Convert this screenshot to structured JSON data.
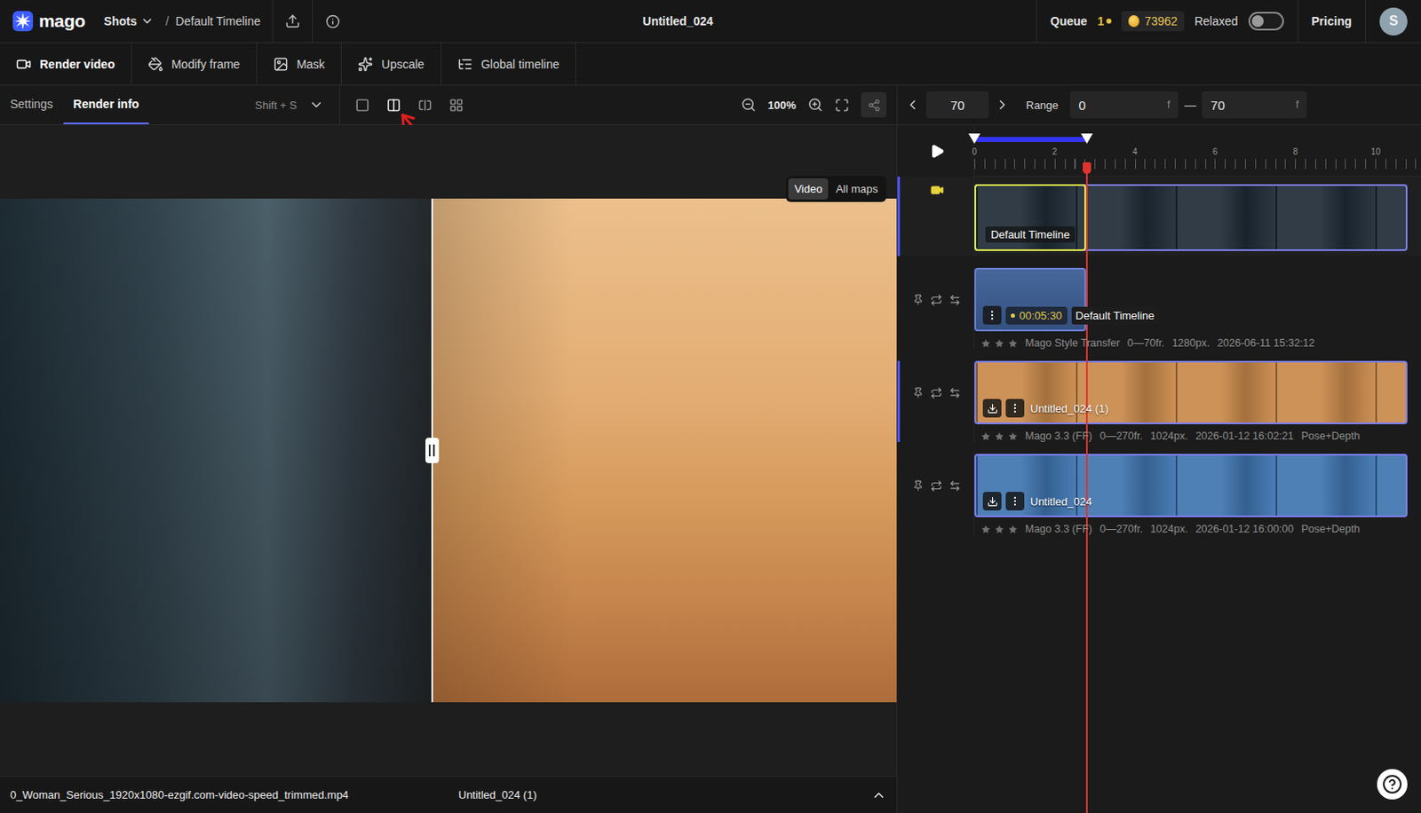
{
  "topbar": {
    "logo": "mago",
    "project": "Shots",
    "separator": "/",
    "timeline": "Default Timeline",
    "title": "Untitled_024",
    "queue": "Queue",
    "queue_count": "1",
    "credits": "73962",
    "relaxed": {
      "label": "Relaxed",
      "on": false
    },
    "pricing": "Pricing",
    "avatar": "S"
  },
  "tools": [
    {
      "label": "Render video",
      "selected": true
    },
    {
      "label": "Modify frame",
      "selected": false
    },
    {
      "label": "Mask",
      "selected": false
    },
    {
      "label": "Upscale",
      "selected": false
    },
    {
      "label": "Global timeline",
      "selected": false
    }
  ],
  "panel_tabs": [
    {
      "label": "Settings",
      "selected": false
    },
    {
      "label": "Render info",
      "selected": true
    }
  ],
  "shortcut": "Shift + S",
  "view_modes": [
    {
      "selected": false
    },
    {
      "selected": true
    },
    {
      "selected": false
    },
    {
      "selected": false
    }
  ],
  "zoom": "100%",
  "preview": {
    "modes": [
      {
        "label": "Video",
        "selected": true
      },
      {
        "label": "All maps",
        "selected": false
      }
    ],
    "split": 0.482
  },
  "footer": {
    "source": "0_Woman_Serious_1920x1080-ezgif.com-video-speed_trimmed.mp4",
    "result": "Untitled_024 (1)"
  },
  "timeline": {
    "frame": "70",
    "range_label": "Range",
    "range_start": "0",
    "range_end": "70",
    "unit": "f",
    "dash": "—",
    "ticks": [
      "0",
      "2",
      "4",
      "6",
      "8",
      "10"
    ],
    "playhead": 0.252,
    "range": 0.252
  },
  "tracks": [
    {
      "kind": "video",
      "name": "Default Timeline",
      "level": 0.97,
      "selected": true,
      "color": "#1f2b36"
    },
    {
      "kind": "style",
      "name": "Default Timeline",
      "duration": "00:05:30",
      "level": 0.25,
      "selected": false,
      "stars": 0,
      "meta": [
        "Mago Style Transfer",
        "0—70fr.",
        "1280px.",
        "2026-06-11 15:32:12"
      ],
      "color": "#3d5f96"
    },
    {
      "kind": "clip",
      "name": "Untitled_024 (1)",
      "level": 0.97,
      "selected": true,
      "stars": 0,
      "meta": [
        "Mago 3.3 (FF)",
        "0—270fr.",
        "1024px.",
        "2026-01-12 16:02:21",
        "Pose+Depth"
      ],
      "color": "#c9894a"
    },
    {
      "kind": "clip",
      "name": "Untitled_024",
      "level": 0.97,
      "selected": false,
      "stars": 0,
      "meta": [
        "Mago 3.3 (FF)",
        "0—270fr.",
        "1024px.",
        "2026-01-12 16:00:00",
        "Pose+Depth"
      ],
      "color": "#3f75b0"
    }
  ]
}
